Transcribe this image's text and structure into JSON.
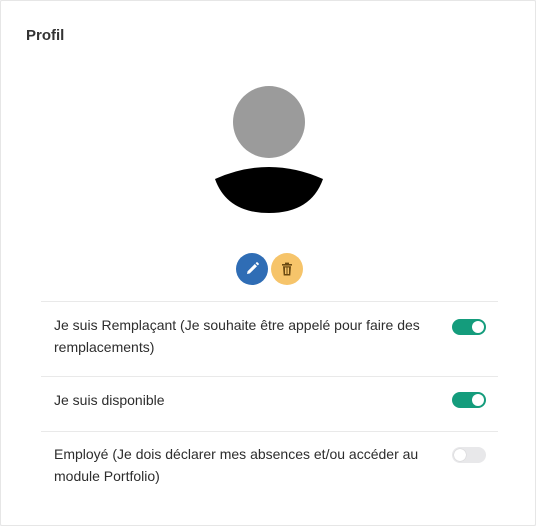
{
  "profile": {
    "title": "Profil",
    "avatar_icon": "user-silhouette-icon",
    "edit_icon": "pencil-icon",
    "delete_icon": "trash-icon",
    "colors": {
      "edit_button": "#2f6db5",
      "delete_button": "#f6c46a",
      "toggle_on": "#149c7c",
      "toggle_off": "#e8e8ea"
    }
  },
  "settings": [
    {
      "label": "Je suis Remplaçant (Je souhaite être appelé pour faire des remplacements)",
      "enabled": true
    },
    {
      "label": "Je suis disponible",
      "enabled": true
    },
    {
      "label": "Employé (Je dois déclarer mes absences et/ou accéder au module Portfolio)",
      "enabled": false
    }
  ]
}
